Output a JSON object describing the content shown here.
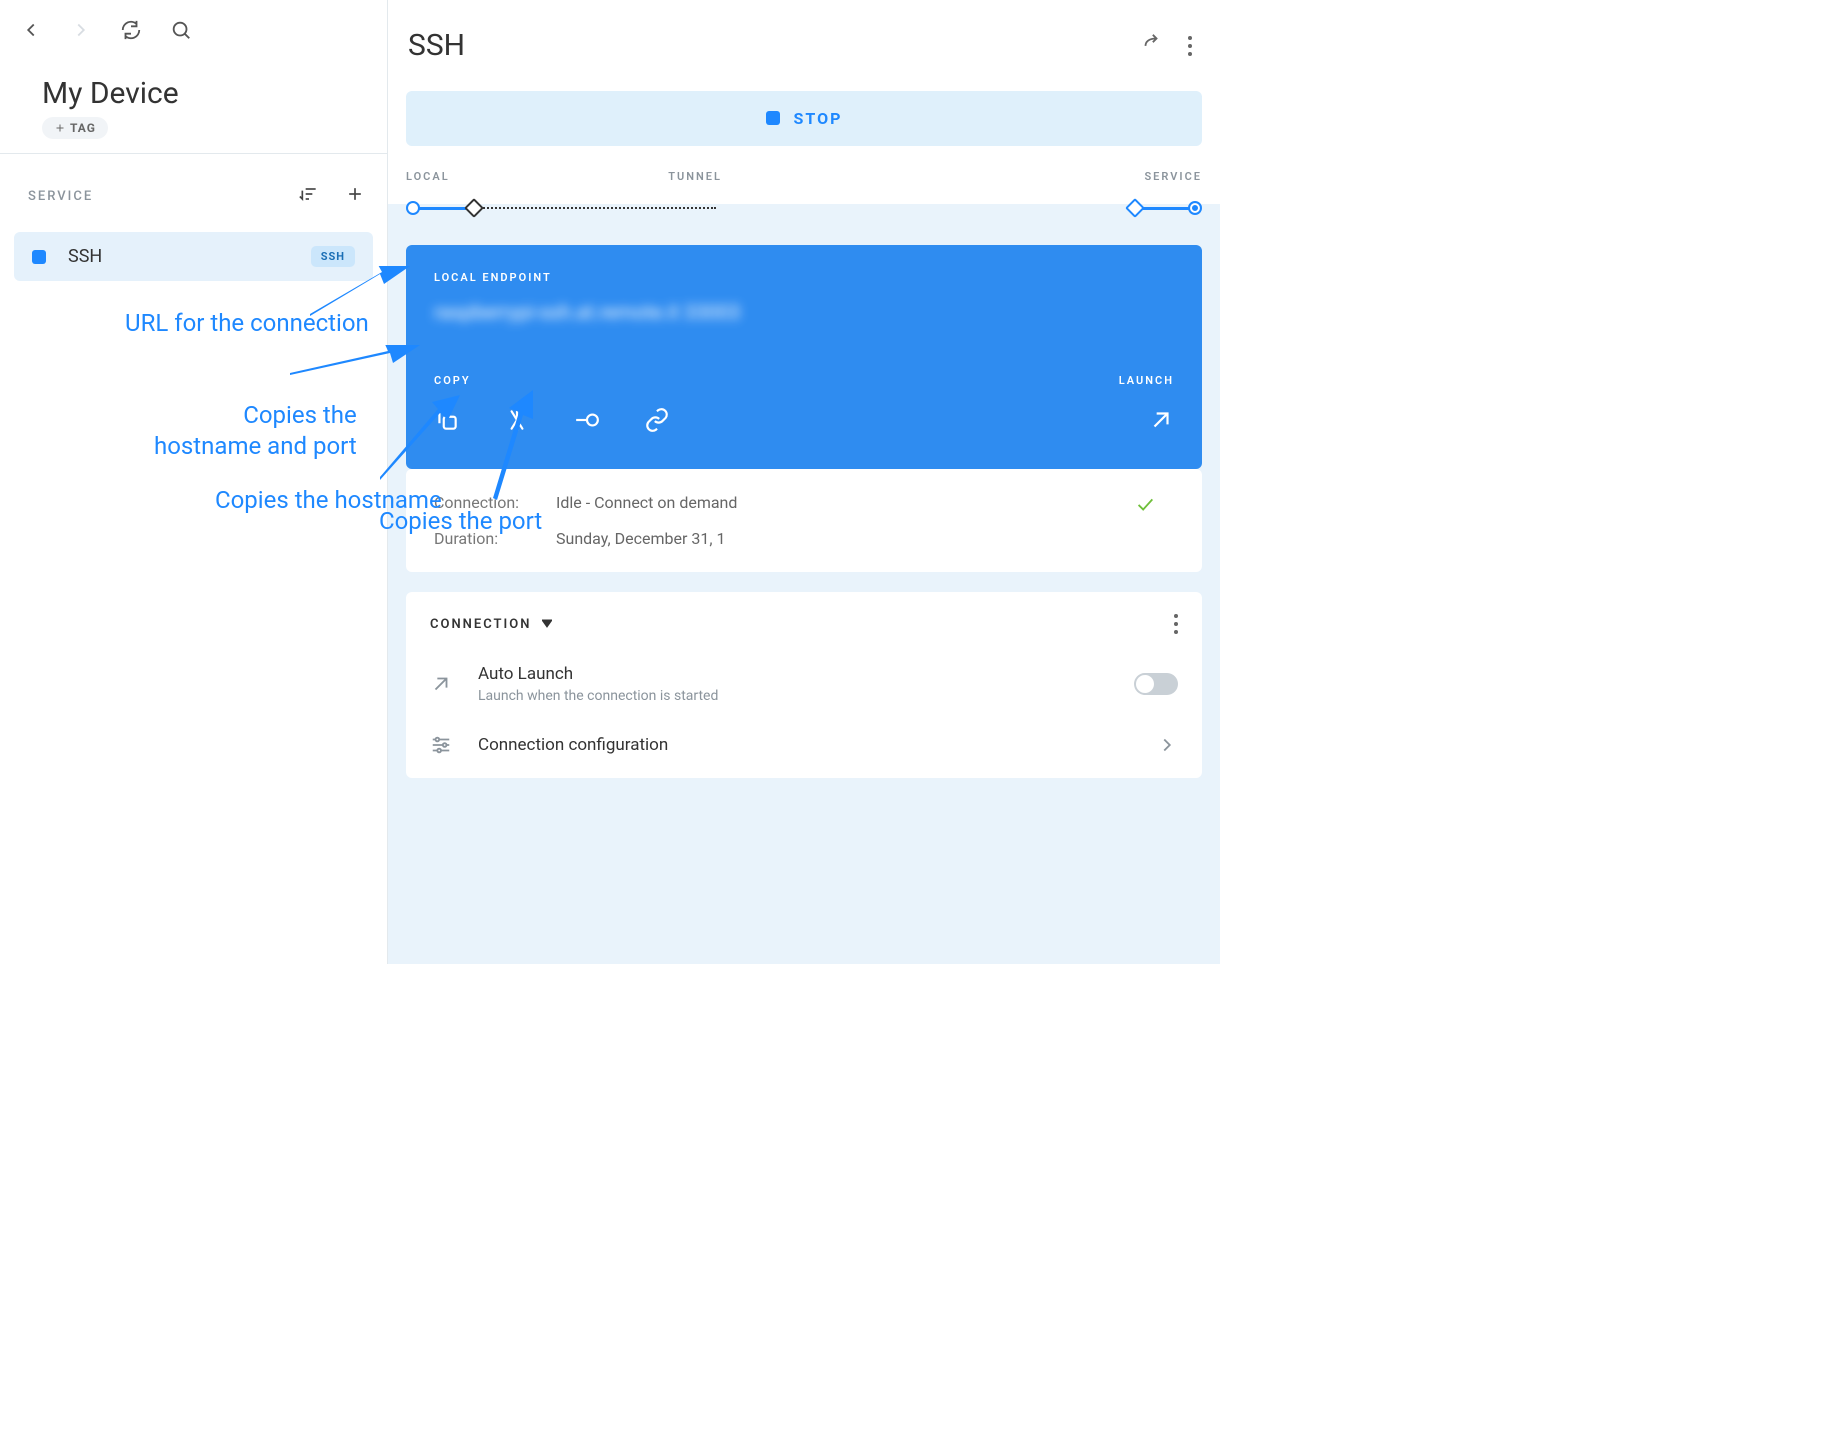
{
  "left": {
    "device_name": "My Device",
    "tag_btn": "TAG",
    "service_label": "SERVICE",
    "service": {
      "name": "SSH",
      "badge": "SSH"
    }
  },
  "right": {
    "title": "SSH",
    "stop_label": "STOP",
    "bar": {
      "local": "LOCAL",
      "tunnel": "TUNNEL",
      "service": "SERVICE"
    },
    "endpoint": {
      "label": "LOCAL ENDPOINT",
      "value": "raspberrypi-ssh.at.remote.it 33003",
      "copy": "COPY",
      "launch": "LAUNCH"
    },
    "info": {
      "connection_label": "Connection:",
      "connection_value": "Idle - Connect on demand",
      "duration_label": "Duration:",
      "duration_value": "Sunday, December 31, 1"
    },
    "connection": {
      "heading": "CONNECTION",
      "auto_launch": "Auto Launch",
      "auto_launch_sub": "Launch when the connection is started",
      "config": "Connection configuration"
    }
  },
  "annotations": {
    "url": "URL for the connection",
    "copy_both": "Copies the\nhostname and port",
    "copy_host": "Copies the hostname",
    "copy_port": "Copies the port"
  }
}
